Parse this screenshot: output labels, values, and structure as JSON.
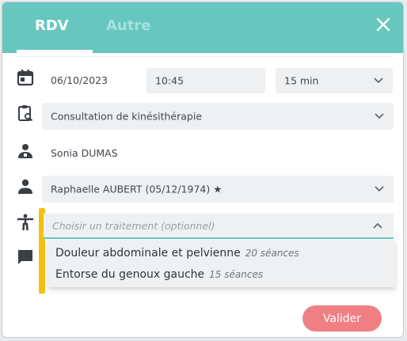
{
  "tabs": [
    {
      "label": "RDV",
      "active": true
    },
    {
      "label": "Autre",
      "active": false
    }
  ],
  "close_icon": "close-icon",
  "appointment": {
    "date": "06/10/2023",
    "time": "10:45",
    "duration": "15 min"
  },
  "consultation_type": "Consultation de kinésithérapie",
  "practitioner": "Sonia DUMAS",
  "patient": "Raphaelle AUBERT (05/12/1974) ★",
  "treatment": {
    "placeholder": "Choisir un traitement (optionnel)",
    "options": [
      {
        "label": "Douleur abdominale et pelvienne",
        "sessions": "20 séances"
      },
      {
        "label": "Entorse du genoux gauche",
        "sessions": "15 séances"
      }
    ]
  },
  "submit_label": "Valider",
  "colors": {
    "header": "#67c7bf",
    "accent": "#f2c10f",
    "button": "#f07f84"
  }
}
